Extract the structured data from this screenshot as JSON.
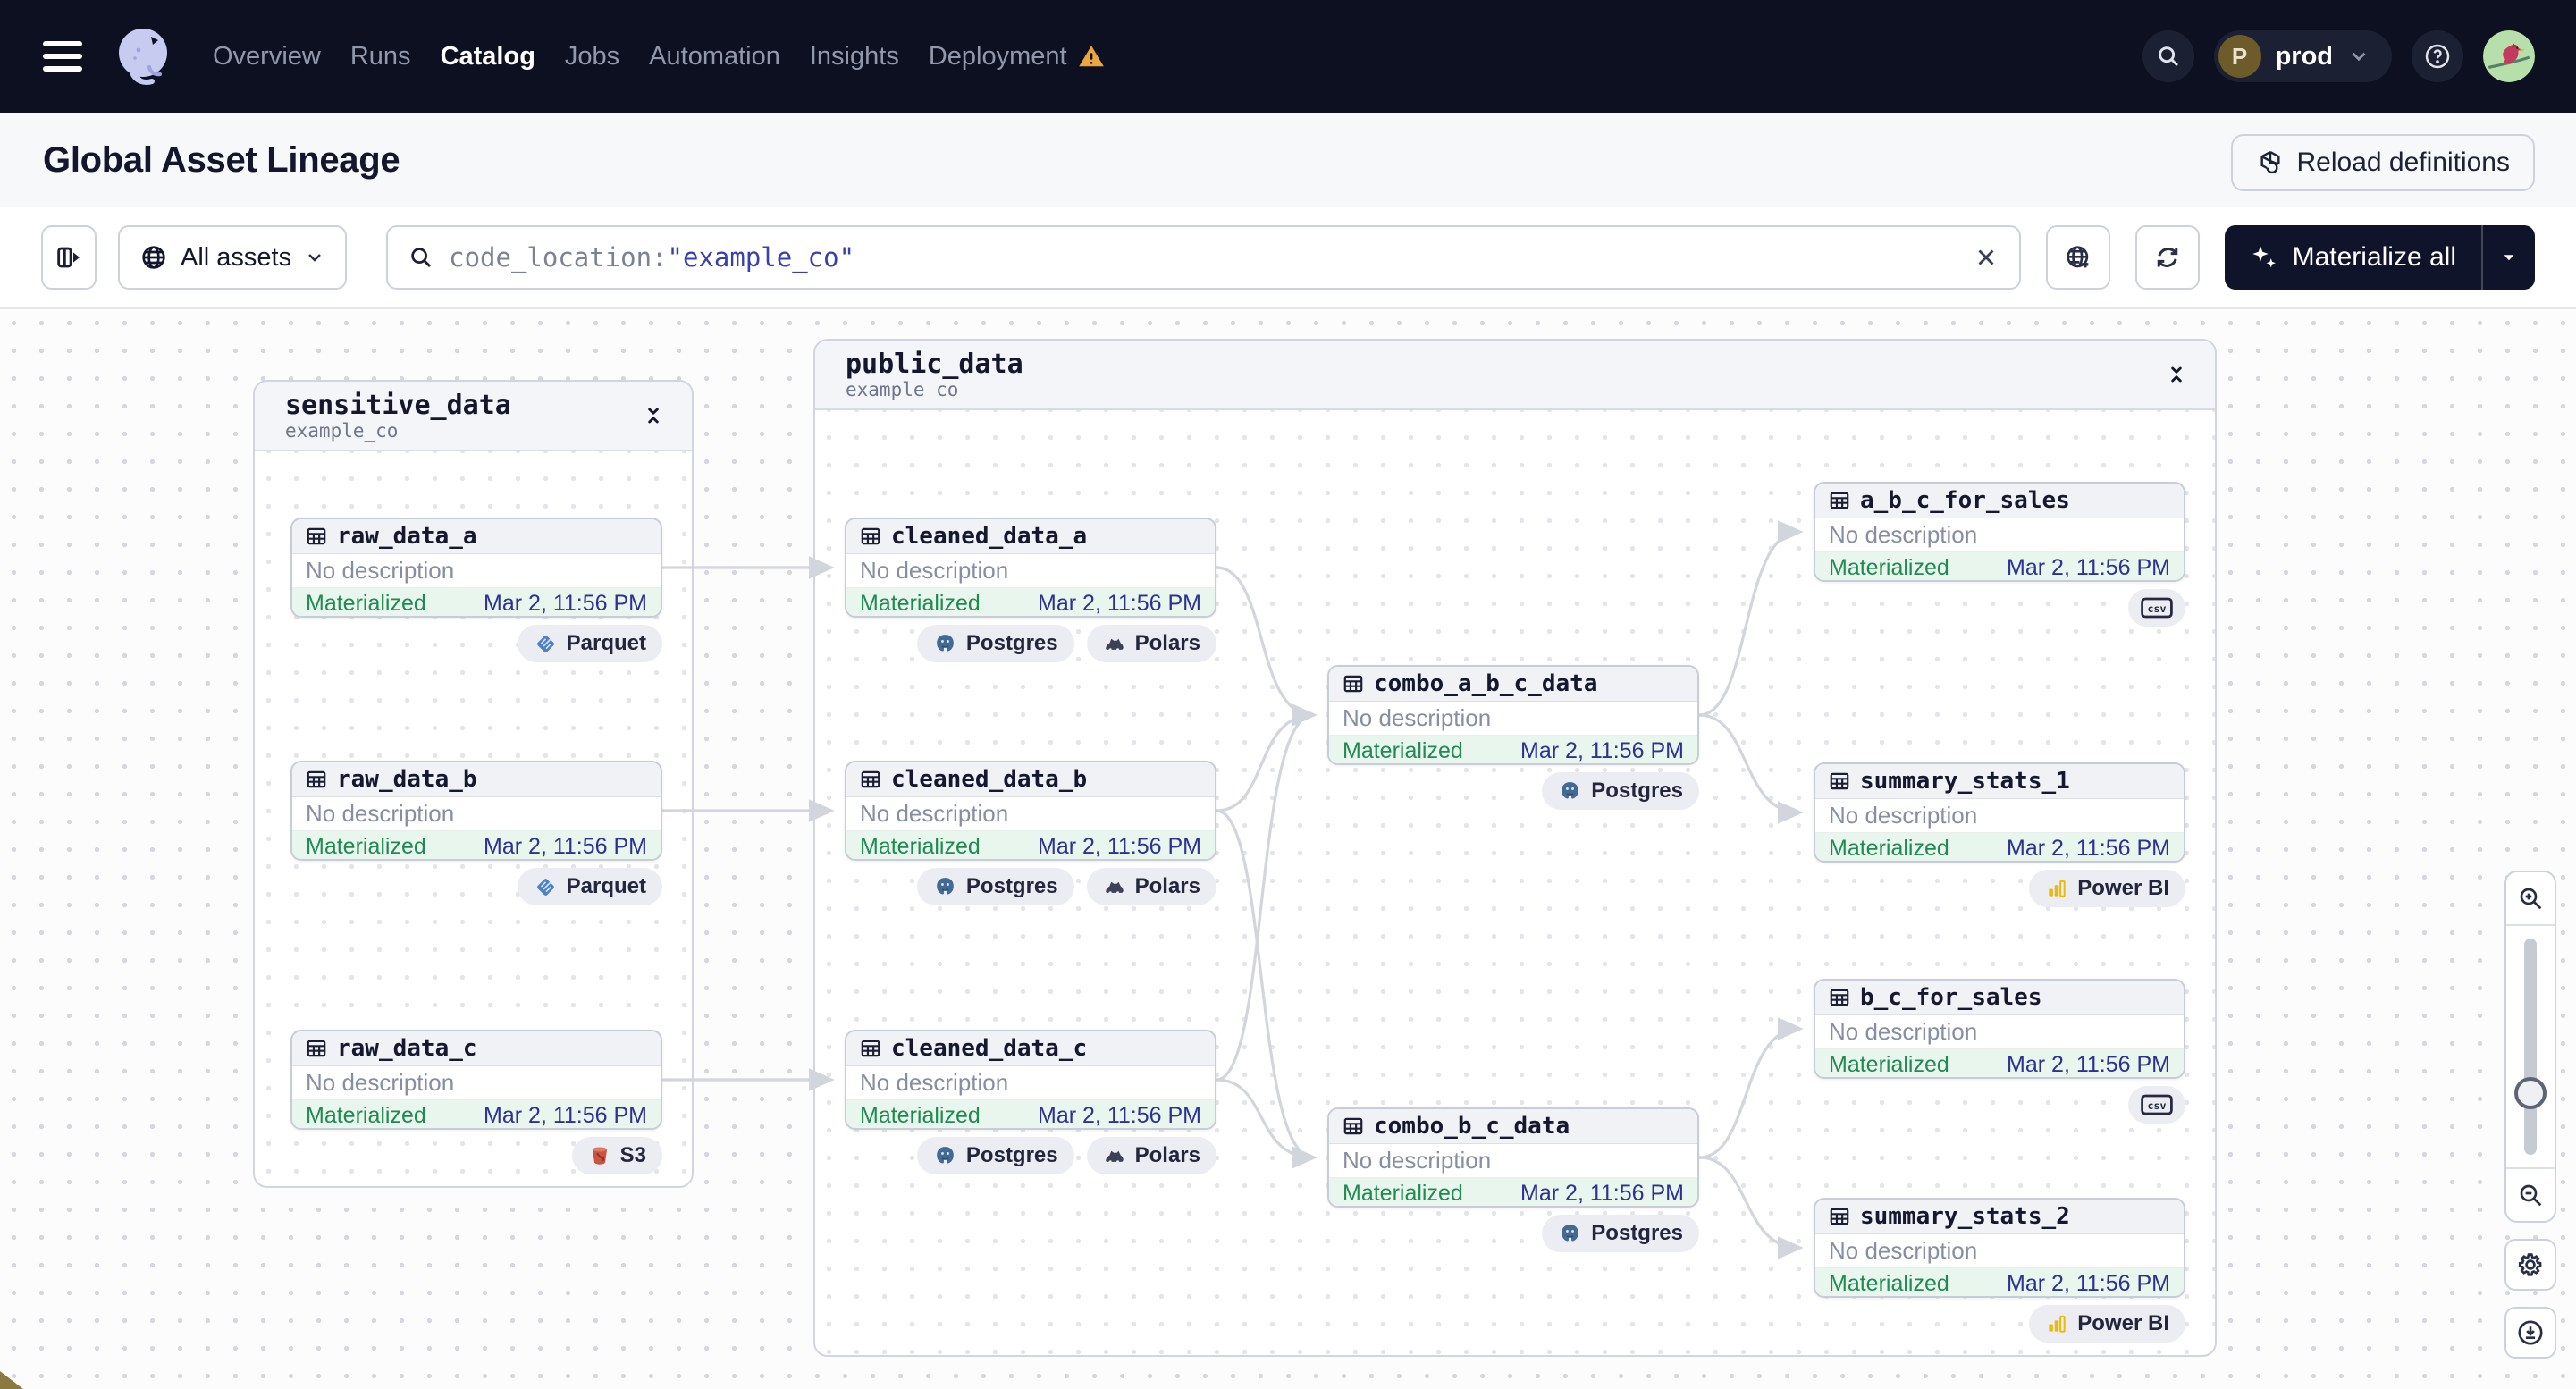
{
  "nav": {
    "items": [
      {
        "label": "Overview",
        "active": false,
        "warning": false
      },
      {
        "label": "Runs",
        "active": false,
        "warning": false
      },
      {
        "label": "Catalog",
        "active": true,
        "warning": false
      },
      {
        "label": "Jobs",
        "active": false,
        "warning": false
      },
      {
        "label": "Automation",
        "active": false,
        "warning": false
      },
      {
        "label": "Insights",
        "active": false,
        "warning": false
      },
      {
        "label": "Deployment",
        "active": false,
        "warning": true
      }
    ],
    "env": "prod",
    "env_initial": "P",
    "icons": [
      "menu-icon",
      "dagster-logo",
      "search-icon",
      "help-icon",
      "user-avatar"
    ]
  },
  "header": {
    "title": "Global Asset Lineage",
    "reload_label": "Reload definitions"
  },
  "toolbar": {
    "scope_label": "All assets",
    "search_prefix": "code_location:",
    "search_quoted": "\"example_co\"",
    "materialize_label": "Materialize all",
    "icons": [
      "panel-toggle-icon",
      "globe-icon",
      "clear-icon",
      "globe-add-icon",
      "refresh-icon",
      "sparkles-icon",
      "caret-down-icon"
    ]
  },
  "graph": {
    "groups": [
      {
        "name": "sensitive_data",
        "subtitle": "example_co",
        "nodes": [
          {
            "name": "raw_data_a",
            "description": "No description",
            "status": "Materialized",
            "timestamp": "Mar 2, 11:56 PM",
            "tags": [
              {
                "label": "Parquet",
                "icon": "parquet"
              }
            ]
          },
          {
            "name": "raw_data_b",
            "description": "No description",
            "status": "Materialized",
            "timestamp": "Mar 2, 11:56 PM",
            "tags": [
              {
                "label": "Parquet",
                "icon": "parquet"
              }
            ]
          },
          {
            "name": "raw_data_c",
            "description": "No description",
            "status": "Materialized",
            "timestamp": "Mar 2, 11:56 PM",
            "tags": [
              {
                "label": "S3",
                "icon": "s3"
              }
            ]
          }
        ]
      },
      {
        "name": "public_data",
        "subtitle": "example_co",
        "nodes": [
          {
            "name": "cleaned_data_a",
            "description": "No description",
            "status": "Materialized",
            "timestamp": "Mar 2, 11:56 PM",
            "tags": [
              {
                "label": "Postgres",
                "icon": "postgres"
              },
              {
                "label": "Polars",
                "icon": "polars"
              }
            ]
          },
          {
            "name": "cleaned_data_b",
            "description": "No description",
            "status": "Materialized",
            "timestamp": "Mar 2, 11:56 PM",
            "tags": [
              {
                "label": "Postgres",
                "icon": "postgres"
              },
              {
                "label": "Polars",
                "icon": "polars"
              }
            ]
          },
          {
            "name": "cleaned_data_c",
            "description": "No description",
            "status": "Materialized",
            "timestamp": "Mar 2, 11:56 PM",
            "tags": [
              {
                "label": "Postgres",
                "icon": "postgres"
              },
              {
                "label": "Polars",
                "icon": "polars"
              }
            ]
          },
          {
            "name": "combo_a_b_c_data",
            "description": "No description",
            "status": "Materialized",
            "timestamp": "Mar 2, 11:56 PM",
            "tags": [
              {
                "label": "Postgres",
                "icon": "postgres"
              }
            ]
          },
          {
            "name": "combo_b_c_data",
            "description": "No description",
            "status": "Materialized",
            "timestamp": "Mar 2, 11:56 PM",
            "tags": [
              {
                "label": "Postgres",
                "icon": "postgres"
              }
            ]
          },
          {
            "name": "a_b_c_for_sales",
            "description": "No description",
            "status": "Materialized",
            "timestamp": "Mar 2, 11:56 PM",
            "tags": [
              {
                "label": "",
                "icon": "csv"
              }
            ]
          },
          {
            "name": "summary_stats_1",
            "description": "No description",
            "status": "Materialized",
            "timestamp": "Mar 2, 11:56 PM",
            "tags": [
              {
                "label": "Power BI",
                "icon": "powerbi"
              }
            ]
          },
          {
            "name": "b_c_for_sales",
            "description": "No description",
            "status": "Materialized",
            "timestamp": "Mar 2, 11:56 PM",
            "tags": [
              {
                "label": "",
                "icon": "csv"
              }
            ]
          },
          {
            "name": "summary_stats_2",
            "description": "No description",
            "status": "Materialized",
            "timestamp": "Mar 2, 11:56 PM",
            "tags": [
              {
                "label": "Power BI",
                "icon": "powerbi"
              }
            ]
          }
        ]
      }
    ],
    "edges": [
      [
        "raw_data_a",
        "cleaned_data_a"
      ],
      [
        "raw_data_b",
        "cleaned_data_b"
      ],
      [
        "raw_data_c",
        "cleaned_data_c"
      ],
      [
        "cleaned_data_a",
        "combo_a_b_c_data"
      ],
      [
        "cleaned_data_b",
        "combo_a_b_c_data"
      ],
      [
        "cleaned_data_c",
        "combo_a_b_c_data"
      ],
      [
        "cleaned_data_b",
        "combo_b_c_data"
      ],
      [
        "cleaned_data_c",
        "combo_b_c_data"
      ],
      [
        "combo_a_b_c_data",
        "a_b_c_for_sales"
      ],
      [
        "combo_a_b_c_data",
        "summary_stats_1"
      ],
      [
        "combo_b_c_data",
        "b_c_for_sales"
      ],
      [
        "combo_b_c_data",
        "summary_stats_2"
      ]
    ],
    "controls": [
      "zoom-in",
      "zoom-slider",
      "zoom-out",
      "settings",
      "download"
    ]
  },
  "colors": {
    "nav_bg": "#0c1021",
    "accent_dark": "#10142b",
    "materialized_green": "#208a52",
    "status_bg": "#e8f6ee",
    "timestamp_blue": "#2d3190",
    "query_blue": "#3a3fae",
    "warning_orange": "#eda73c",
    "edge_gray": "#d2d5db"
  }
}
